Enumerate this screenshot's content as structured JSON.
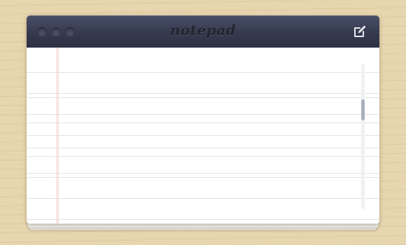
{
  "window": {
    "title": "notepad"
  },
  "icons": {
    "compose": "edit-compose-icon"
  },
  "note": {
    "content": "",
    "placeholder": ""
  },
  "colors": {
    "title_bar": "#363a4f",
    "title_text": "#22242f",
    "background_wood": "#e6d5ad",
    "paper": "#ffffff",
    "rule_line": "#e2e2e2",
    "margin_line": "#f1c4c4",
    "scrollbar_thumb": "#a9b0bc"
  }
}
